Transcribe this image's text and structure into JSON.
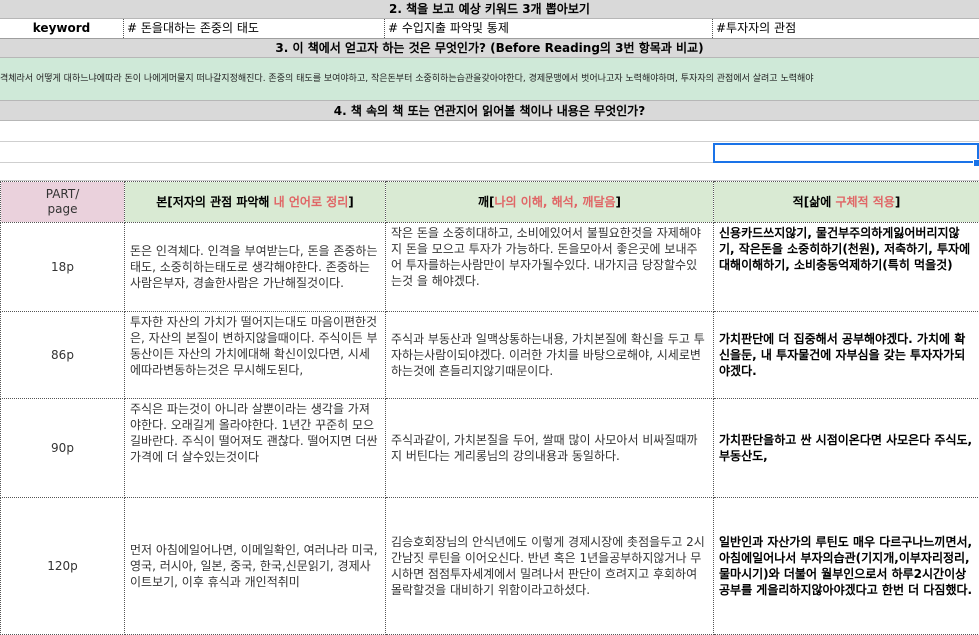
{
  "section2": {
    "title": "2. 책을 보고 예상 키워드 3개 뽑아보기",
    "keyword_label": "keyword",
    "kw1": "# 돈을대하는 존중의 태도",
    "kw2": "# 수입지출 파악및 통제",
    "kw3": "#투자자의 관점"
  },
  "section3": {
    "title": "3. 이 책에서 얻고자 하는 것은 무엇인가? (Before Reading의 3번 항목과 비교)",
    "text": "격체라서 어떻게 대하느냐에따라 돈이 나에게머물지 떠나갈지정해진다. 존중의 태도를 보여야하고, 작은돈부터 소중히하는습관을갖아야한다, 경제문맹에서 벗어나고자 노력해야하며, 투자자의 관점에서 살려고 노력해야"
  },
  "section4": {
    "title": "4. 책 속의 책 또는 연관지어 읽어볼 책이나 내용은 무엇인가?"
  },
  "table": {
    "headers": {
      "part": "PART/\npage",
      "col_bon_prefix": "본[",
      "col_bon_main": "저자의 관점 파악해 ",
      "col_bon_red": "내 언어로 정리",
      "col_bon_suffix": "]",
      "col_kkae_prefix": "깨[",
      "col_kkae_red": "나의 이해, 해석, 깨달음",
      "col_kkae_suffix": "]",
      "col_jeok_prefix": "적[삶에 ",
      "col_jeok_red": "구체적 적용",
      "col_jeok_suffix": "]"
    },
    "rows": [
      {
        "page": "18p",
        "bon": "돈은 인격체다. 인격을 부여받는다, 돈을 존중하는태도, 소중히하는태도로 생각해야한다. 존중하는사람은부자, 경솔한사람은 가난해질것이다.",
        "kkae": "작은 돈을 소중히대하고, 소비에있어서 불필요한것을 자제해야지 돈을 모으고 투자가 가능하다. 돈을모아서 좋은곳에 보내주어 투자를하는사람만이 부자가될수있다. 내가지금 당장할수있는것 을 해야겠다.",
        "jeok": "신용카드쓰지않기, 물건부주의하게잃어버리지않기, 작은돈을 소중히하기(천원), 저축하기, 투자에대해이해하기, 소비충동억제하기(특히 먹을것)"
      },
      {
        "page": "86p",
        "bon": "투자한 자산의 가치가 떨어지는대도 마음이편한것은, 자산의 본질이 변하지않을때이다. 주식이든 부동산이든 자산의 가치에대해 확신이있다면, 시세에따라변동하는것은 무시해도된다,",
        "kkae": "주식과 부동산과 일맥상통하는내용, 가치본질에 확신을 두고 투자하는사람이되야겠다. 이러한 가치를 바탕으로해야, 시세로변하는것에 흔들리지않기때문이다.",
        "jeok": "가치판단에 더 집중해서 공부해야겠다. 가치에 확신을둔, 내 투자물건에 자부심을 갖는 투자자가되야겠다."
      },
      {
        "page": "90p",
        "bon": "주식은 파는것이 아니라 살뿐이라는 생각을 가져야한다. 오래길게 올라야한다. 1년간 꾸준히 모으길바란다. 주식이 떨어져도 괜찮다. 떨어지면 더싼가격에 더 살수있는것이다",
        "kkae": "주식과같이, 가치본질을 두어, 쌀때 많이 사모아서 비싸질때까지 버틴다는 게리롱님의 강의내용과 동일하다.",
        "jeok": "가치판단을하고 싼 시점이온다면 사모은다 주식도, 부동산도,"
      },
      {
        "page": "120p",
        "bon": "먼저 아침에일어나면, 이메일확인, 여러나라 미국, 영국, 러시아, 일본, 중국, 한국,신문읽기, 경제사이트보기, 이후 휴식과 개인적취미",
        "kkae": "김승호회장님의 안식년에도 이렇게 경제시장에 촛점을두고 2시간남짓 루틴을 이어오신다. 반년 혹은 1년을공부하지않거나 무시하면 점점투자세계에서 밀려나서 판단이 흐려지고 후회하여 몰락할것을 대비하기 위함이라고하셨다.",
        "jeok": "일반인과 자산가의 루틴도 매우 다르구나느끼면서, 아침에일어나서 부자의습관(기지개,이부자리정리, 물마시기)와 더불어 월부인으로서 하루2시간이상 공부를 게을리하지않아야겠다고 한번 더 다짐했다."
      }
    ]
  },
  "colors": {
    "band_gray": "#d9d9d9",
    "green_row": "#cfe9d8",
    "part_header": "#ead1dc",
    "header_green": "#d9ead3",
    "accent_red": "#e06666",
    "selection_blue": "#1a73e8"
  }
}
